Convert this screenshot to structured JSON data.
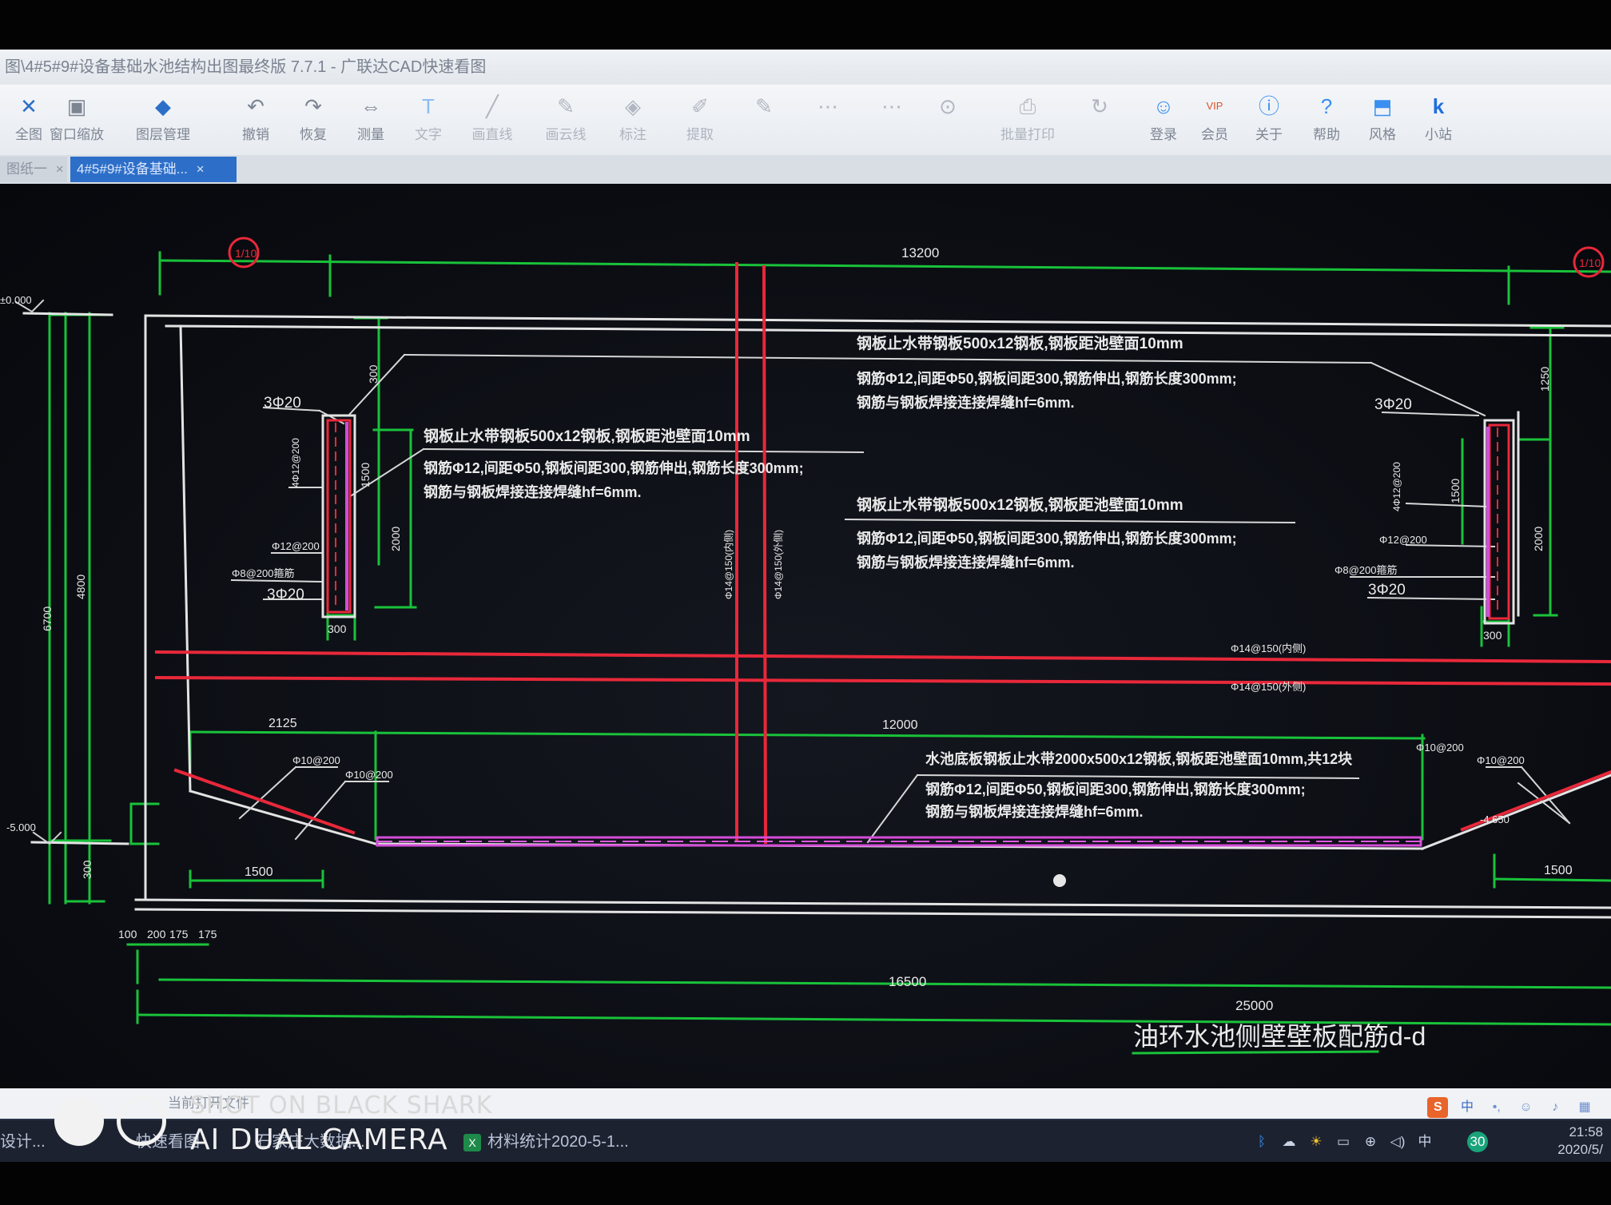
{
  "window": {
    "title": "图\\4#5#9#设备基础水池结构出图最终版 7.7.1 - 广联达CAD快速看图"
  },
  "ribbon": {
    "tools": [
      {
        "id": "tool-1",
        "label": "全图",
        "icon": "fullview-icon"
      },
      {
        "id": "tool-2",
        "label": "窗口缩放",
        "icon": "window-zoom-icon"
      },
      {
        "id": "tool-3",
        "label": "图层管理",
        "icon": "layer-manager-icon"
      },
      {
        "id": "tool-4",
        "label": "撤销",
        "icon": "undo-icon"
      },
      {
        "id": "tool-5",
        "label": "恢复",
        "icon": "redo-icon"
      },
      {
        "id": "tool-6",
        "label": "测量",
        "icon": "measure-icon"
      },
      {
        "id": "tool-7",
        "label": "文字",
        "icon": "text-icon"
      },
      {
        "id": "tool-8",
        "label": "画直线",
        "icon": "line-icon"
      },
      {
        "id": "tool-9",
        "label": "画云线",
        "icon": "pen-icon"
      },
      {
        "id": "tool-10",
        "label": "标注",
        "icon": "annotate-icon"
      },
      {
        "id": "tool-11",
        "label": "提取",
        "icon": "extract-icon"
      },
      {
        "id": "tool-12",
        "label": "",
        "icon": "edit-icon"
      },
      {
        "id": "tool-13",
        "label": "",
        "icon": "brush-icon"
      },
      {
        "id": "tool-14",
        "label": "",
        "icon": "dots-icon"
      },
      {
        "id": "tool-15",
        "label": "",
        "icon": "pin-icon"
      },
      {
        "id": "tool-16",
        "label": "批量打印",
        "icon": "print-icon"
      },
      {
        "id": "tool-17",
        "label": "",
        "icon": "refresh-icon"
      },
      {
        "id": "tool-18",
        "label": "登录",
        "icon": "user-icon"
      },
      {
        "id": "tool-19",
        "label": "会员",
        "icon": "vip-icon"
      },
      {
        "id": "tool-20",
        "label": "关于",
        "icon": "info-icon"
      },
      {
        "id": "tool-21",
        "label": "帮助",
        "icon": "help-icon"
      },
      {
        "id": "tool-22",
        "label": "风格",
        "icon": "style-icon"
      },
      {
        "id": "tool-23",
        "label": "小站",
        "icon": "k-logo-icon"
      }
    ]
  },
  "tabs": [
    {
      "label": "图纸一",
      "close": "×",
      "active": false
    },
    {
      "label": "4#5#9#设备基础...",
      "close": "×",
      "active": true
    }
  ],
  "drawing": {
    "axis_left": "1/10",
    "axis_right": "1/10",
    "dims_top": [
      "13200"
    ],
    "dims_bottom": [
      "16500",
      "25000"
    ],
    "dims_small_bottom": [
      "100",
      "200",
      "175",
      "175"
    ],
    "dim_inner_left": "2125",
    "dim_inner_center": "12000",
    "dim_bottom_left_1500": "1500",
    "dim_bottom_right_1500": "1500",
    "dim_left_col_300": "300",
    "dim_right_col_300": "300",
    "dim_left_vert_a": "6700",
    "dim_left_vert_b": "4800",
    "dim_left_vert_c": "300",
    "dim_left_vert_d": "1500",
    "dim_left_vert_e": "2000",
    "dim_left_vert_f": "300",
    "dim_right_vert_a": "1250",
    "dim_right_vert_b": "1500",
    "dim_right_vert_c": "2000",
    "level_left_top": "±0.000",
    "level_left_bottom": "-5.000",
    "level_right_bottom": "-4.650",
    "bar_3d20_tl": "3Φ20",
    "bar_3d20_bl": "3Φ20",
    "bar_3d20_tr": "3Φ20",
    "bar_3d20_br": "3Φ20",
    "stirrup_left": "Φ12@200",
    "stirrup_right": "Φ12@200",
    "stirrup_left_2": "Φ8@200箍筋",
    "stirrup_right_2": "Φ8@200箍筋",
    "side_bar_left": "4Φ12@200",
    "side_bar_right": "4Φ12@200",
    "bottom_bar_left_1": "Φ10@200",
    "bottom_bar_left_2": "Φ10@200",
    "bottom_bar_right_1": "Φ10@200",
    "bottom_bar_right_2": "Φ10@200",
    "horiz_bar_1": "Φ14@150(内侧)",
    "horiz_bar_2": "Φ14@150(外侧)",
    "vert_bar_1": "Φ14@150(内侧)",
    "vert_bar_2": "Φ14@150(外侧)",
    "note_a_1": "钢板止水带钢板500x12钢板,钢板距池壁面10mm",
    "note_a_2": "钢筋Φ12,间距Φ50,钢板间距300,钢筋伸出,钢筋长度300mm;",
    "note_a_3": "钢筋与钢板焊接连接焊缝hf=6mm.",
    "note_b_1": "钢板止水带钢板500x12钢板,钢板距池壁面10mm",
    "note_b_2": "钢筋Φ12,间距Φ50,钢板间距300,钢筋伸出,钢筋长度300mm;",
    "note_b_3": "钢筋与钢板焊接连接焊缝hf=6mm.",
    "note_c_1": "钢板止水带钢板500x12钢板,钢板距池壁面10mm",
    "note_c_2": "钢筋Φ12,间距Φ50,钢板间距300,钢筋伸出,钢筋长度300mm;",
    "note_c_3": "钢筋与钢板焊接连接焊缝hf=6mm.",
    "note_d_1": "水池底板钢板止水带2000x500x12钢板,钢板距池壁面10mm,共12块",
    "note_d_2": "钢筋Φ12,间距Φ50,钢板间距300,钢筋伸出,钢筋长度300mm;",
    "note_d_3": "钢筋与钢板焊接连接焊缝hf=6mm.",
    "section_title": "油环水池侧壁壁板配筋d-d"
  },
  "status_bar": {
    "text": "当前打开文件",
    "ime_s": "S",
    "ime_cn": "中"
  },
  "taskbar": {
    "left_item": "设计...",
    "item_1": "快速看图",
    "item_2": "石家庄大数据...",
    "item_3": "材料统计2020-5-1...",
    "tray": [
      "bluetooth-icon",
      "cloud-icon",
      "weather-icon",
      "battery-icon",
      "network-icon",
      "volume-icon"
    ],
    "tray_lang": "中",
    "tray_badge": "30",
    "clock_time": "21:58",
    "clock_date": "2020/5/"
  },
  "watermark": {
    "line1": "SHOT ON BLACK SHARK",
    "line2": "AI DUAL CAMERA"
  },
  "colors": {
    "accent": "#2d6fc8",
    "cad_green": "#19c23a",
    "cad_red": "#e8283a",
    "cad_white": "#e6e6e6",
    "cad_magenta": "#d44cd8"
  }
}
